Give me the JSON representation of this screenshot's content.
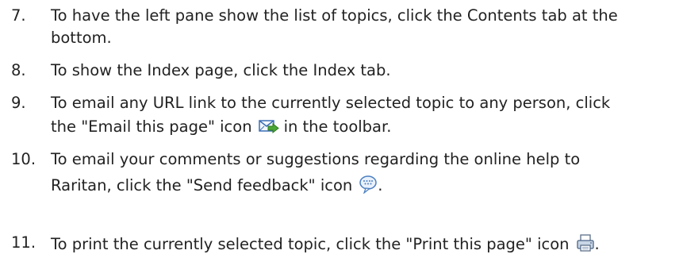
{
  "steps": [
    {
      "number": "7.",
      "line1": "To have the left pane show the list of topics, click the Contents tab at the",
      "line2": "bottom."
    },
    {
      "number": "8.",
      "line1": "To show the Index page, click the Index tab."
    },
    {
      "number": "9.",
      "line1": "To email any URL link to the currently selected topic to any person, click",
      "line2_before": "the \"Email this page\" icon",
      "line2_after": "in the toolbar.",
      "icon": "email-page-icon"
    },
    {
      "number": "10.",
      "line1": "To email your comments or suggestions regarding the online help to",
      "line2_before": "Raritan, click the \"Send feedback\" icon",
      "line2_after": ".",
      "icon": "send-feedback-icon"
    },
    {
      "number": "11.",
      "line1_before": "To print the currently selected topic, click the \"Print this page\" icon",
      "line1_after": ".",
      "icon": "print-page-icon"
    }
  ]
}
